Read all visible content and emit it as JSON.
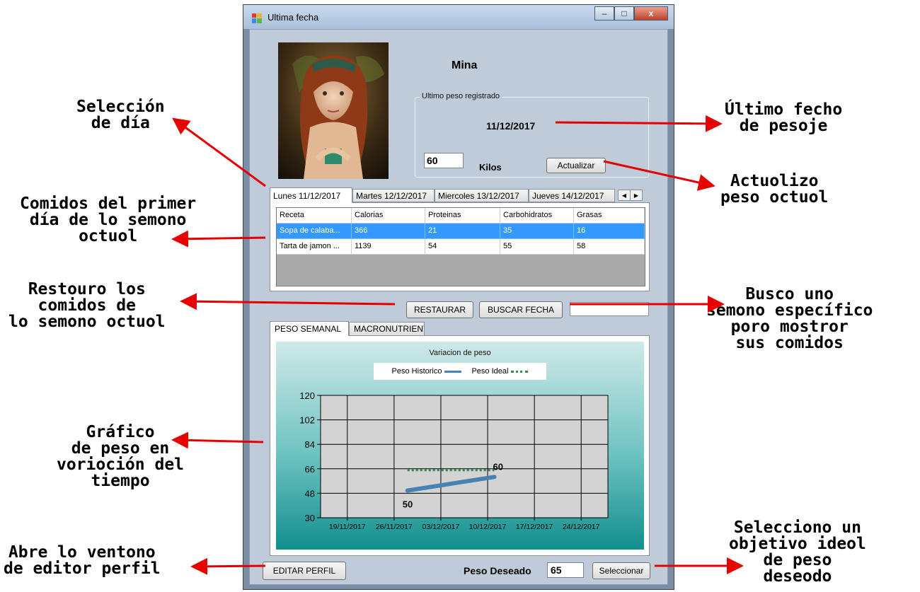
{
  "window": {
    "title": "Ultima fecha",
    "controls": {
      "minimize": "–",
      "maximize": "□",
      "close": "x"
    }
  },
  "profile": {
    "name": "Mina",
    "group_label": "Ultimo peso registrado",
    "last_date": "11/12/2017",
    "weight_value": "60",
    "weight_unit": "Kilos",
    "update_button": "Actualizar"
  },
  "day_tabs": [
    "Lunes 11/12/2017",
    "Martes 12/12/2017",
    "Miercoles 13/12/2017",
    "Jueves 14/12/2017"
  ],
  "table": {
    "headers": [
      "Receta",
      "Calorias",
      "Proteinas",
      "Carbohidratos",
      "Grasas"
    ],
    "rows": [
      [
        "Sopa de calaba...",
        "366",
        "21",
        "35",
        "16"
      ],
      [
        "Tarta de jamon ...",
        "1139",
        "54",
        "55",
        "58"
      ]
    ]
  },
  "buttons": {
    "restore": "RESTAURAR",
    "search_date": "BUSCAR FECHA",
    "edit_profile": "EDITAR PERFIL",
    "select": "Seleccionar"
  },
  "search_value": "",
  "chart_tabs": [
    "PESO SEMANAL",
    "MACRONUTRIENT"
  ],
  "goal": {
    "label": "Peso Deseado",
    "value": "65"
  },
  "chart_data": {
    "type": "line",
    "title": "Variacion de peso",
    "x_ticks": [
      "19/11/2017",
      "26/11/2017",
      "03/12/2017",
      "10/12/2017",
      "17/12/2017",
      "24/12/2017"
    ],
    "y_ticks": [
      "120",
      "102",
      "84",
      "66",
      "48",
      "30"
    ],
    "ylim": [
      30,
      120
    ],
    "grid": true,
    "legend_position": "top",
    "series": [
      {
        "name": "Peso Historico",
        "color": "#4682b4",
        "style": "solid",
        "points": [
          [
            "2017-11-28",
            50
          ],
          [
            "2017-12-11",
            60
          ]
        ],
        "point_labels": [
          "50",
          "60"
        ]
      },
      {
        "name": "Peso Ideal",
        "color": "#2e8b57",
        "style": "dotted",
        "points": [
          [
            "2017-11-28",
            65
          ],
          [
            "2017-12-11",
            65
          ]
        ]
      }
    ]
  },
  "annotations": {
    "dia": "Selección\nde día",
    "comidas": "Comidos del primer\ndía de lo semono\noctuol",
    "restaura": "Restouro los\ncomidos de\nlo semono octuol",
    "grafica": "Gráfico\nde peso en\nvorioción del\ntiempo",
    "editor": "Abre lo ventono\nde editor perfil",
    "ultima": "Último fecho\nde pesoje",
    "actualiza": "Actuolizo\npeso octuol",
    "busca": "Busco uno\nsemono específico\nporo mostror\nsus comidos",
    "selecciona": "Selecciono un\nobjetivo ideol\nde peso\ndeseodo"
  }
}
